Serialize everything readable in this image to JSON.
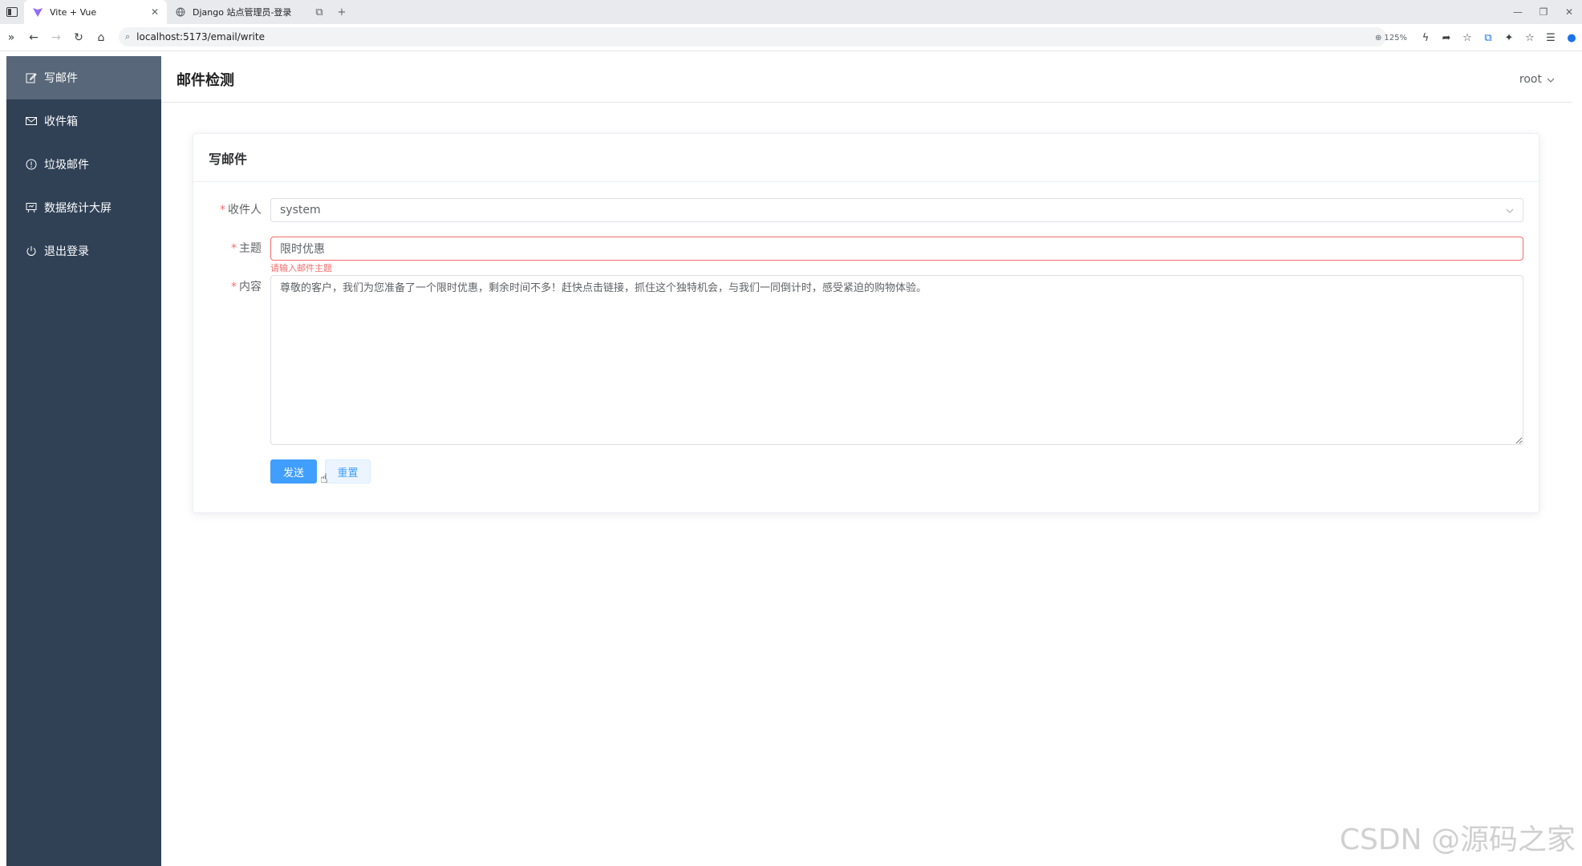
{
  "browser": {
    "tabs": [
      {
        "title": "Vite + Vue",
        "active": true
      },
      {
        "title": "Django 站点管理员-登录",
        "active": false
      }
    ],
    "url": "localhost:5173/email/write",
    "zoom": "125%"
  },
  "app": {
    "title": "邮件检测",
    "user": "root"
  },
  "sidebar": {
    "items": [
      {
        "label": "写邮件",
        "icon": "edit-icon",
        "active": true
      },
      {
        "label": "收件箱",
        "icon": "mail-icon",
        "active": false
      },
      {
        "label": "垃圾邮件",
        "icon": "warning-icon",
        "active": false
      },
      {
        "label": "数据统计大屏",
        "icon": "presentation-icon",
        "active": false
      },
      {
        "label": "退出登录",
        "icon": "power-icon",
        "active": false
      }
    ]
  },
  "form": {
    "card_title": "写邮件",
    "recipient": {
      "label": "收件人",
      "value": "system"
    },
    "subject": {
      "label": "主题",
      "value": "限时优惠",
      "error": "请输入邮件主题"
    },
    "content": {
      "label": "内容",
      "value": "尊敬的客户，我们为您准备了一个限时优惠，剩余时间不多！赶快点击链接，抓住这个独特机会，与我们一同倒计时，感受紧迫的购物体验。"
    },
    "send_label": "发送",
    "reset_label": "重置"
  },
  "watermark": "CSDN @源码之家",
  "colors": {
    "sidebar_bg": "#304156",
    "sidebar_active": "#586779",
    "primary": "#409eff",
    "danger": "#f56c6c"
  }
}
